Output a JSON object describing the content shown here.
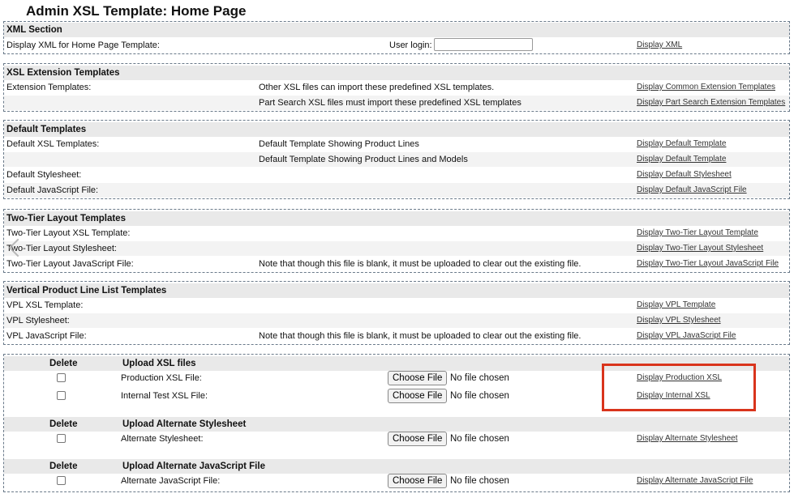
{
  "page_title": "Admin XSL Template: Home Page",
  "xml_section": {
    "header": "XML Section",
    "label": "Display XML for Home Page Template:",
    "login_label": "User login:",
    "login_value": "",
    "link": "Display XML"
  },
  "ext_section": {
    "header": "XSL Extension Templates",
    "rows": [
      {
        "label": "Extension Templates:",
        "desc": "Other XSL files can import these predefined XSL templates.",
        "link": "Display Common Extension Templates"
      },
      {
        "label": "",
        "desc": "Part Search XSL files must import these predefined XSL templates",
        "link": "Display Part Search Extension Templates"
      }
    ]
  },
  "default_section": {
    "header": "Default Templates",
    "rows": [
      {
        "label": "Default XSL Templates:",
        "desc": "Default Template Showing Product Lines",
        "link": "Display Default Template"
      },
      {
        "label": "",
        "desc": "Default Template Showing Product Lines and Models",
        "link": "Display Default Template"
      },
      {
        "label": "Default Stylesheet:",
        "desc": "",
        "link": "Display Default Stylesheet"
      },
      {
        "label": "Default JavaScript File:",
        "desc": "",
        "link": "Display Default JavaScript File"
      }
    ]
  },
  "twotier_section": {
    "header": "Two-Tier Layout Templates",
    "rows": [
      {
        "label": "Two-Tier Layout XSL Template:",
        "desc": "",
        "link": "Display Two-Tier Layout Template"
      },
      {
        "label": "Two-Tier Layout Stylesheet:",
        "desc": "",
        "link": "Display Two-Tier Layout Stylesheet"
      },
      {
        "label": "Two-Tier Layout JavaScript File:",
        "desc": "Note that though this file is blank, it must be uploaded to clear out the existing file.",
        "link": "Display Two-Tier Layout JavaScript File"
      }
    ]
  },
  "vpl_section": {
    "header": "Vertical Product Line List Templates",
    "rows": [
      {
        "label": "VPL XSL Template:",
        "desc": "",
        "link": "Display VPL Template"
      },
      {
        "label": "VPL Stylesheet:",
        "desc": "",
        "link": "Display VPL Stylesheet"
      },
      {
        "label": "VPL JavaScript File:",
        "desc": "Note that though this file is blank, it must be uploaded to clear out the existing file.",
        "link": "Display VPL JavaScript File"
      }
    ]
  },
  "upload_section": {
    "delete_label": "Delete",
    "choose_file": "Choose File",
    "no_file": "No file chosen",
    "groups": [
      {
        "title": "Upload XSL files",
        "rows": [
          {
            "label": "Production XSL File:",
            "link": "Display Production XSL"
          },
          {
            "label": "Internal Test XSL File:",
            "link": "Display Internal XSL"
          }
        ]
      },
      {
        "title": "Upload Alternate Stylesheet",
        "rows": [
          {
            "label": "Alternate Stylesheet:",
            "link": "Display Alternate Stylesheet"
          }
        ]
      },
      {
        "title": "Upload Alternate JavaScript File",
        "rows": [
          {
            "label": "Alternate JavaScript File:",
            "link": "Display Alternate JavaScript File"
          }
        ]
      }
    ]
  },
  "colors": {
    "highlight": "#d9341c",
    "header_bg": "#e9e9e9",
    "alt_bg": "#f3f3f3"
  }
}
